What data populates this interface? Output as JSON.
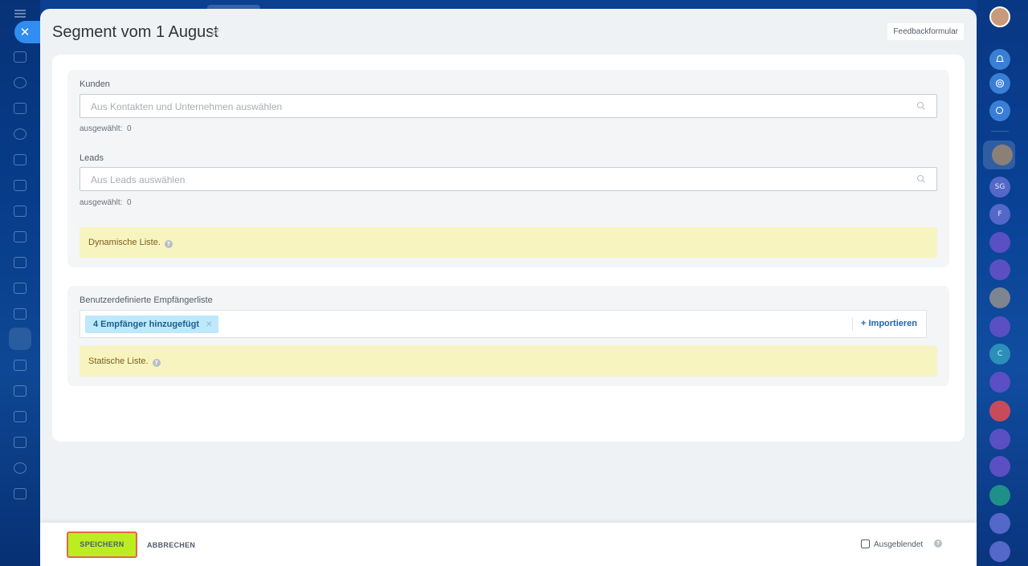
{
  "header": {
    "title": "Segment vom 1 August",
    "feedback_label": "Feedbackformular"
  },
  "customers": {
    "label": "Kunden",
    "placeholder": "Aus Kontakten und Unternehmen auswählen",
    "selected_label": "ausgewählt:",
    "selected_count": "0"
  },
  "leads": {
    "label": "Leads",
    "placeholder": "Aus Leads auswählen",
    "selected_label": "ausgewählt:",
    "selected_count": "0"
  },
  "dynamic_notice": "Dynamische Liste.",
  "custom_list": {
    "label": "Benutzerdefinierte Empfängerliste",
    "tag": "4 Empfänger hinzugefügt",
    "import_label": "+ Importieren",
    "static_notice": "Statische Liste."
  },
  "footer": {
    "save_label": "SPEICHERN",
    "cancel_label": "ABBRECHEN",
    "hidden_label": "Ausgeblendet"
  },
  "right_rail": {
    "avatars": [
      "SG",
      "F",
      "C"
    ]
  },
  "colors": {
    "accent_save": "#bbed21",
    "notice_bg": "#f7f4c0",
    "tag_bg": "#bde9fb"
  }
}
